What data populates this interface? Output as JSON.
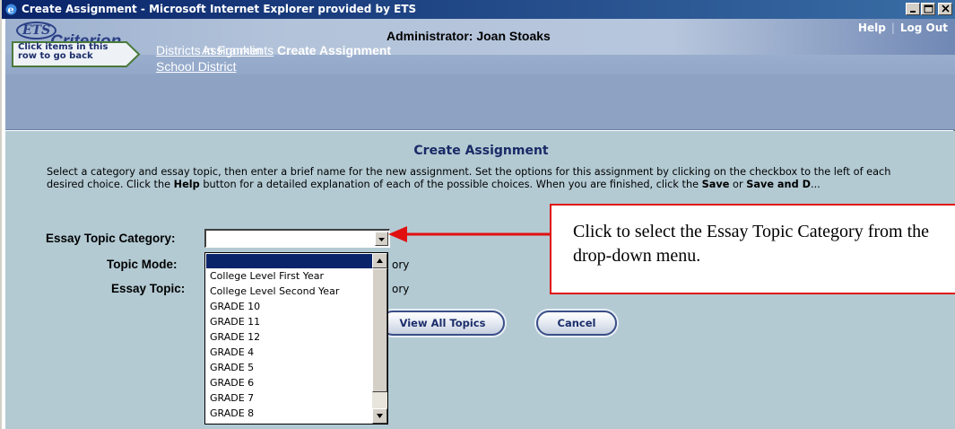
{
  "window": {
    "title": "Create Assignment - Microsoft Internet Explorer provided by ETS"
  },
  "header": {
    "logo_ets": "ETS",
    "logo_name": "Criterion.",
    "admin_label": "Administrator: Joan Stoaks",
    "help_label": "Help",
    "logout_label": "Log Out"
  },
  "breadcrumb": {
    "back_hint_line1": "Click items in this",
    "back_hint_line2": "row to go back",
    "item1_line1": "Districts in Franklin",
    "item1_line2": "School District",
    "item2": "Assignments",
    "current": "Create Assignment"
  },
  "main": {
    "title": "Create Assignment",
    "intro_part1": "Select a category and essay topic, then enter a brief name for the new assignment. Set the options for this assignment by clicking on the checkbox to the left of each desired choice. Click the ",
    "intro_help": "Help",
    "intro_part2": " button for a detailed explanation of each of the possible choices. When you are finished, click the ",
    "intro_save": "Save",
    "intro_or": " or ",
    "intro_save_and": "Save and D",
    "intro_tail": "...",
    "category_label": "Essay Topic Category:",
    "category_value": "",
    "topic_mode_label": "Topic Mode:",
    "topic_mode_partial": "ory",
    "essay_topic_label": "Essay Topic:",
    "essay_topic_partial": "ory",
    "view_all_topics_label": "View All Topics",
    "cancel_label": "Cancel"
  },
  "dropdown": {
    "options": [
      "",
      "College Level First Year",
      "College Level Second Year",
      "GRADE 10",
      "GRADE 11",
      "GRADE 12",
      "GRADE 4",
      "GRADE 5",
      "GRADE 6",
      "GRADE 7",
      "GRADE 8"
    ],
    "selected_index": 0
  },
  "callout": {
    "text": "Click to select the Essay Topic Category from the drop-down menu."
  },
  "colors": {
    "titlebar": "#0a246a",
    "header": "#8ea2c4",
    "content": "#b3cad3",
    "callout_border": "#e01010"
  }
}
